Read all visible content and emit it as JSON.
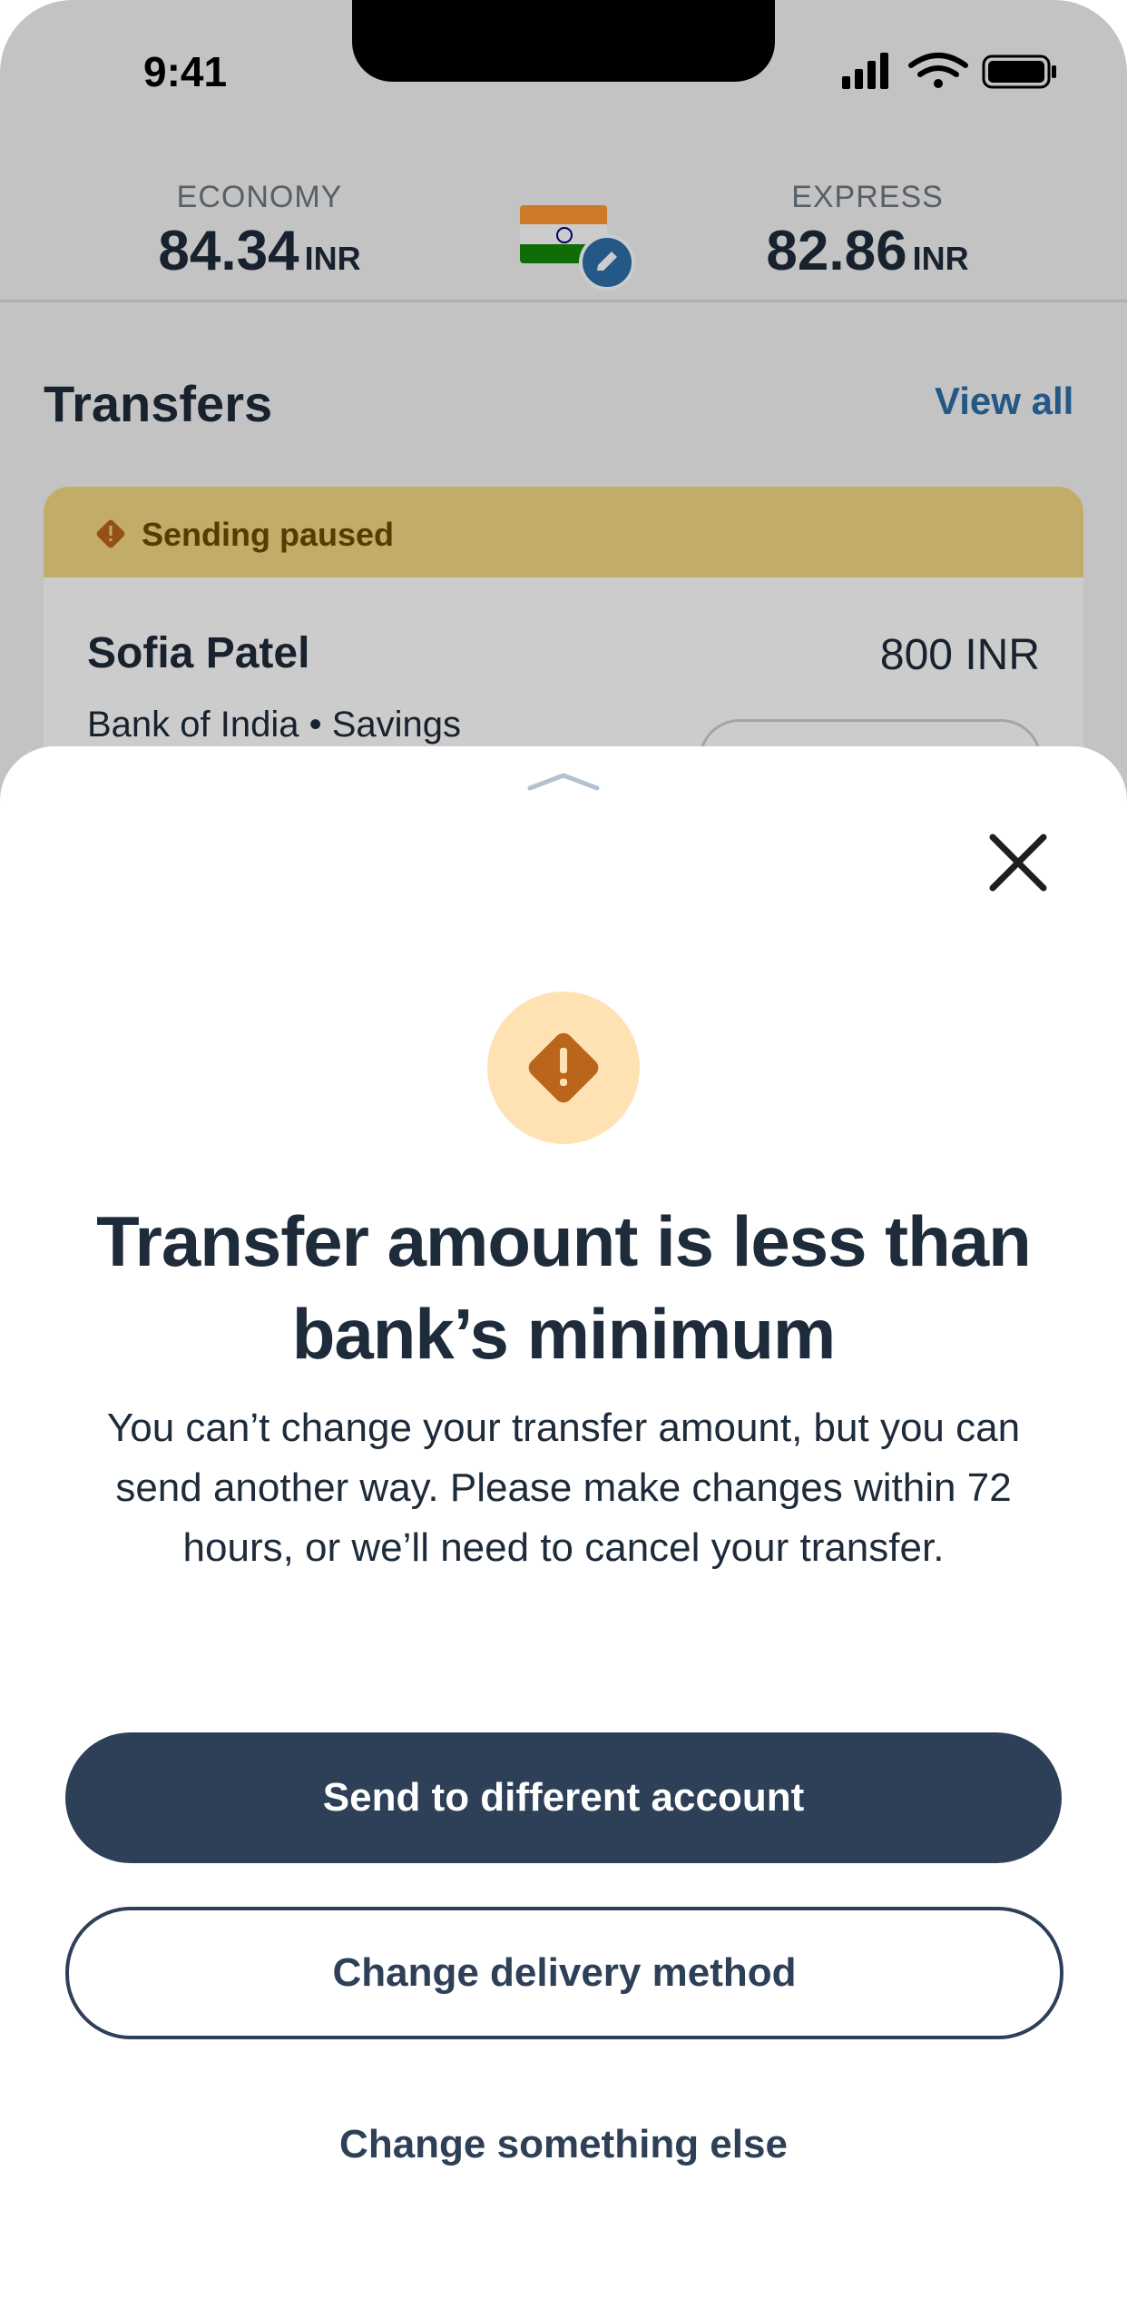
{
  "status_bar": {
    "time": "9:41"
  },
  "rates": {
    "economy": {
      "label": "ECONOMY",
      "value": "84.34",
      "unit": "INR"
    },
    "express": {
      "label": "EXPRESS",
      "value": "82.86",
      "unit": "INR"
    },
    "flag_icon": "india-flag-icon",
    "edit_icon": "pencil-icon"
  },
  "transfers": {
    "title": "Transfers",
    "view_all": "View all",
    "card": {
      "banner": "Sending paused",
      "name": "Sofia Patel",
      "amount": "800 INR",
      "bank": "Bank of India • Savings"
    }
  },
  "sheet": {
    "title": "Transfer amount is less than bank’s minimum",
    "body": "You can’t change your transfer amount, but you can send another way. Please make changes within 72 hours, or we’ll need to cancel your transfer.",
    "primary_button": "Send to different account",
    "secondary_button": "Change delivery method",
    "tertiary_button": "Change something else"
  },
  "colors": {
    "primary": "#2e4057",
    "link": "#2e6fa8",
    "warning_bg": "#ffe2b4",
    "warning_icon": "#b9651b",
    "banner_bg": "#f4d883"
  }
}
